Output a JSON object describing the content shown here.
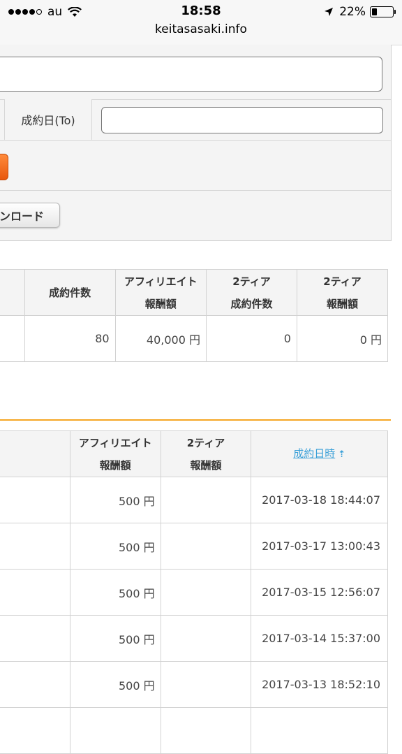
{
  "status_bar": {
    "carrier": "au",
    "time": "18:58",
    "battery": "22%",
    "url": "keitasasaki.info"
  },
  "form": {
    "to_label": "成約日(To)",
    "to_value": "",
    "download_label": "ンロード"
  },
  "summary": {
    "headers": [
      {
        "line1": "成約件数",
        "line2": ""
      },
      {
        "line1": "アフィリエイト",
        "line2": "報酬額"
      },
      {
        "line1": "2ティア",
        "line2": "成約件数"
      },
      {
        "line1": "2ティア",
        "line2": "報酬額"
      }
    ],
    "row": [
      "80",
      "40,000 円",
      "0",
      "0 円"
    ]
  },
  "detail": {
    "headers": [
      {
        "line1": "アフィリエイト",
        "line2": "報酬額"
      },
      {
        "line1": "2ティア",
        "line2": "報酬額"
      }
    ],
    "sort_label": "成約日時",
    "sort_arrow": "⇡",
    "rows": [
      {
        "reward": "500 円",
        "tier2": "",
        "date": "2017-03-18 18:44:07"
      },
      {
        "reward": "500 円",
        "tier2": "",
        "date": "2017-03-17 13:00:43"
      },
      {
        "reward": "500 円",
        "tier2": "",
        "date": "2017-03-15 12:56:07"
      },
      {
        "reward": "500 円",
        "tier2": "",
        "date": "2017-03-14 15:37:00"
      },
      {
        "reward": "500 円",
        "tier2": "",
        "date": "2017-03-13 18:52:10"
      },
      {
        "reward": "",
        "tier2": "",
        "date": ""
      }
    ]
  },
  "colors": {
    "accent_orange": "#f5a623",
    "button_orange": "#e8580e",
    "link_blue": "#3aa0d8"
  }
}
